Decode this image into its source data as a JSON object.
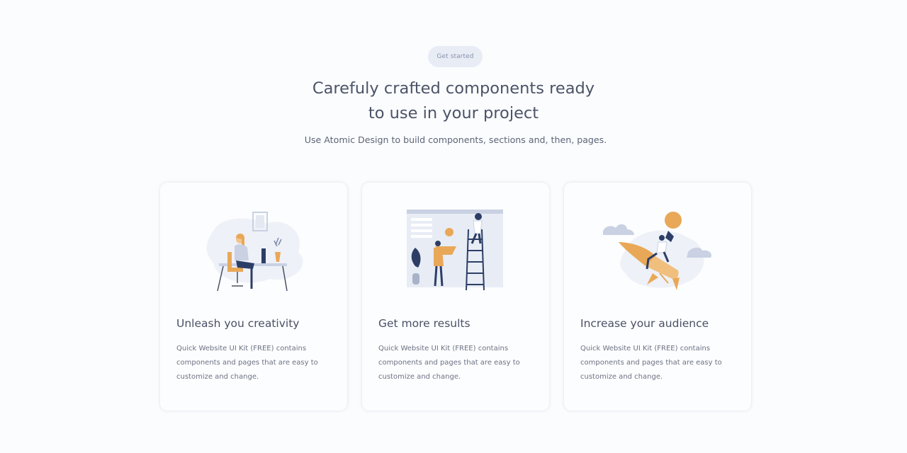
{
  "header": {
    "pill_label": "Get started",
    "title_line1": "Carefuly crafted components ready",
    "title_line2": "to use in your project",
    "subtitle": "Use Atomic Design to build components, sections and, then, pages."
  },
  "cards": [
    {
      "illustration": "woman-at-desk-illustration",
      "title": "Unleash you creativity",
      "text": "Quick Website UI Kit (FREE) contains components and pages that are easy to customize and change."
    },
    {
      "illustration": "team-ladder-board-illustration",
      "title": "Get more results",
      "text": "Quick Website UI Kit (FREE) contains components and pages that are easy to customize and change."
    },
    {
      "illustration": "rocket-launch-illustration",
      "title": "Increase your audience",
      "text": "Quick Website UI Kit (FREE) contains components and pages that are easy to customize and change."
    }
  ],
  "colors": {
    "accent_orange": "#e9a857",
    "navy": "#2d3e66",
    "muted_blue": "#c9d1e3",
    "background": "#fbfcfe"
  }
}
